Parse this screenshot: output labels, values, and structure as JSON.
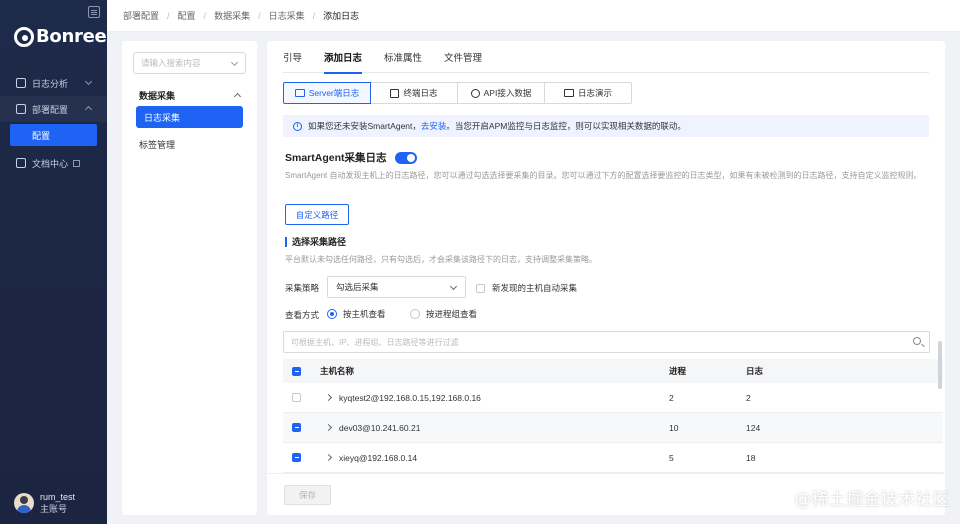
{
  "sidebar": {
    "logo_text": "Bonree",
    "items": [
      {
        "label": "日志分析"
      },
      {
        "label": "部署配置"
      },
      {
        "label": "配置"
      },
      {
        "label": "文档中心"
      }
    ],
    "user": {
      "name": "rum_test",
      "role": "主账号"
    }
  },
  "breadcrumb": [
    "部署配置",
    "配置",
    "数据采集",
    "日志采集",
    "添加日志"
  ],
  "left_panel": {
    "search_placeholder": "请输入搜索内容",
    "group_label": "数据采集",
    "active_item": "日志采集",
    "item": "标签管理"
  },
  "tabs": [
    "引导",
    "添加日志",
    "标准属性",
    "文件管理"
  ],
  "segments": [
    "Server端日志",
    "终端日志",
    "API接入数据",
    "日志演示"
  ],
  "info": {
    "text_before": "如果您还未安装SmartAgent，",
    "link": "去安装",
    "text_after": "。当您开启APM监控与日志监控，则可以实现相关数据的联动。"
  },
  "smartagent": {
    "title": "SmartAgent采集日志",
    "description": "SmartAgent 自动发现主机上的日志路径，您可以通过勾选选择要采集的目录。您可以通过下方的配置选择要监控的日志类型，如果有未被检测到的日志路径，支持自定义监控规则。",
    "custom_button": "自定义路径"
  },
  "collection": {
    "section_title": "选择采集路径",
    "section_desc": "平台默认未勾选任何路径，只有勾选后，才会采集该路径下的日志，支持调整采集策略。",
    "strategy_label": "采集策略",
    "strategy_value": "勾选后采集",
    "auto_label": "新发现的主机自动采集",
    "view_label": "查看方式",
    "view_options": [
      "按主机查看",
      "按进程组查看"
    ],
    "filter_placeholder": "可根据主机、IP、进程组、日志路径等进行过滤"
  },
  "table": {
    "headers": {
      "name": "主机名称",
      "process": "进程",
      "log": "日志"
    },
    "rows": [
      {
        "name": "kyqtest2@192.168.0.15,192.168.0.16",
        "process": "2",
        "log": "2",
        "checked": false
      },
      {
        "name": "dev03@10.241.60.21",
        "process": "10",
        "log": "124",
        "checked": true
      },
      {
        "name": "xieyq@192.168.0.14",
        "process": "5",
        "log": "18",
        "checked": true
      }
    ]
  },
  "footer": {
    "save_label": "保存"
  },
  "watermark": "@稀土掘金技术社区",
  "colors": {
    "accent": "#1f63f5",
    "sidebar_bg": "#1e2a4a",
    "info_bg": "#eef3ff"
  }
}
